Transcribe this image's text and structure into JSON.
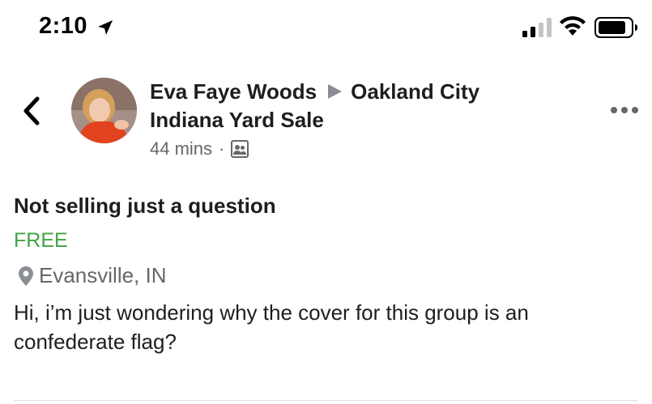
{
  "status_bar": {
    "time": "2:10"
  },
  "post": {
    "author": "Eva Faye Woods",
    "group_line1": "Oakland City",
    "group_line2": "Indiana Yard Sale",
    "timestamp": "44 mins",
    "separator": "·",
    "title": "Not selling just a question",
    "price": "FREE",
    "location": "Evansville, IN",
    "description": "Hi, i’m just wondering why the cover for this group is an confederate flag?"
  },
  "icons": {
    "back": "chevron-left-icon",
    "more": "more-options-icon",
    "audience": "group-audience-icon",
    "location": "location-pin-icon"
  },
  "colors": {
    "price": "#42a346",
    "secondary_text": "#65676b",
    "primary_text": "#1c1e21"
  }
}
